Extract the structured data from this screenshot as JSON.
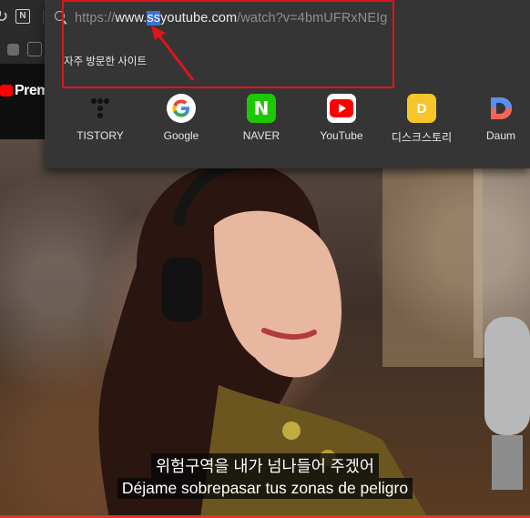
{
  "address_bar": {
    "url_prefix": "https://",
    "url_host_a": "www.",
    "url_host_sel": "ss",
    "url_host_b": "youtube.com",
    "url_path": "/watch?v=4bmUFRxNEIg"
  },
  "dropdown": {
    "section_title": "자주 방문한 사이트",
    "shortcuts": [
      {
        "label": "TISTORY",
        "icon": "tistory-icon"
      },
      {
        "label": "Google",
        "icon": "google-icon"
      },
      {
        "label": "NAVER",
        "icon": "naver-icon"
      },
      {
        "label": "YouTube",
        "icon": "youtube-icon"
      },
      {
        "label": "디스크스토리",
        "icon": "diskstory-icon"
      },
      {
        "label": "Daum",
        "icon": "daum-icon"
      }
    ]
  },
  "page": {
    "yt_brand_partial": "Prem"
  },
  "video": {
    "subtitle_ko": "위험구역을 내가 넘나들어 주겠어",
    "subtitle_es": "Déjame sobrepasar tus zonas de peligro"
  },
  "colors": {
    "annotation_red": "#e0141b",
    "selection_blue": "#3a73d6",
    "youtube_red": "#ff0000",
    "naver_green": "#1ec800",
    "diskstory_yellow": "#f5c52a"
  }
}
